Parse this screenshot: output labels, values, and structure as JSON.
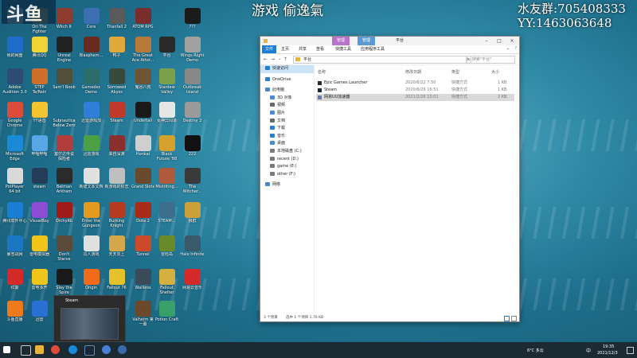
{
  "overlay": {
    "logo": "斗鱼",
    "game_text": "游戏 偷逸氣",
    "qq_group": "水友群:705408333",
    "yy": "YY:1463063648"
  },
  "desktop_icons": [
    {
      "label": "",
      "color": "#cfd6e6"
    },
    {
      "label": "Ori The Fighter",
      "color": "#c2a94a"
    },
    {
      "label": "Witch It",
      "color": "#8c3b2e"
    },
    {
      "label": "Core",
      "color": "#3b6fb1"
    },
    {
      "label": "Titanfall 2",
      "color": "#5a5a5a"
    },
    {
      "label": "ATOM RPG",
      "color": "#7b2c2c"
    },
    {
      "label": "???",
      "color": "#1b1b1b"
    },
    {
      "label": "我的网盘",
      "color": "#1f6ccc"
    },
    {
      "label": "腾讯QQ",
      "color": "#f0d335"
    },
    {
      "label": "Unreal Engine",
      "color": "#222222"
    },
    {
      "label": "Blasphem...",
      "color": "#6a2a20"
    },
    {
      "label": "鸭子",
      "color": "#e0a838"
    },
    {
      "label": "The Great Ace Attor...",
      "color": "#b77a3a"
    },
    {
      "label": "平台",
      "color": "#2a2a2a"
    },
    {
      "label": "Wings Right Demo",
      "color": "#a1a1a1"
    },
    {
      "label": "Adobe Audition 3.0",
      "color": "#2d4c74"
    },
    {
      "label": "STEP Ta/Rein",
      "color": "#cf6f2c"
    },
    {
      "label": "Sam'l Noob",
      "color": "#514e39"
    },
    {
      "label": "Gamedec Demo",
      "color": "#2c6d6a"
    },
    {
      "label": "Sorrowed Abyss",
      "color": "#394a3a"
    },
    {
      "label": "鬼谷八荒",
      "color": "#6d5535"
    },
    {
      "label": "Stardew Valley",
      "color": "#7ba14a"
    },
    {
      "label": "Outbreak Island",
      "color": "#888888"
    },
    {
      "label": "Google Chrome",
      "color": "#dd4c3a"
    },
    {
      "label": "YY语音",
      "color": "#f4c430"
    },
    {
      "label": "Subnautica Below Zero",
      "color": "#1d6d8c"
    },
    {
      "label": "迅雷游戏加",
      "color": "#2f7fd8"
    },
    {
      "label": "Steam",
      "color": "#c0392b"
    },
    {
      "label": "Undertail",
      "color": "#1a1a1a"
    },
    {
      "label": "女神异闻录",
      "color": "#e6e6e6"
    },
    {
      "label": "Destiny 2",
      "color": "#9a9a9a"
    },
    {
      "label": "Microsoft Edge",
      "color": "#1a8ad4"
    },
    {
      "label": "哔哩哔哩",
      "color": "#58a6e5"
    },
    {
      "label": "塞尔达传说 探险者",
      "color": "#b23b3b"
    },
    {
      "label": "迅雷游戏",
      "color": "#4aa042"
    },
    {
      "label": "来自深渊",
      "color": "#8c2f2f"
    },
    {
      "label": "Honkai",
      "color": "#cfcfcf"
    },
    {
      "label": "Black Future '88",
      "color": "#d4a12c"
    },
    {
      "label": "222",
      "color": "#111111"
    },
    {
      "label": "PotPlayer 64 bit",
      "color": "#d9d9d9"
    },
    {
      "label": "steam",
      "color": "#233d58"
    },
    {
      "label": "Batman Arkham",
      "color": "#2b2b2b"
    },
    {
      "label": "新建文本文档",
      "color": "#e0e0e0"
    },
    {
      "label": "新游戏的标志",
      "color": "#bfbfbf"
    },
    {
      "label": "Grand Slots",
      "color": "#6a4a2a"
    },
    {
      "label": "Mistriting...",
      "color": "#b05a3c"
    },
    {
      "label": "The Witcher...",
      "color": "#3a3a3a"
    },
    {
      "label": "腾讯软件中心",
      "color": "#1a7fd4"
    },
    {
      "label": "VisualBoy",
      "color": "#8c4cd4"
    },
    {
      "label": "OrchyRb",
      "color": "#a01a1a"
    },
    {
      "label": "Enter the Gungeon",
      "color": "#e39a20"
    },
    {
      "label": "Burning Knight",
      "color": "#b53a1f"
    },
    {
      "label": "Dota 2",
      "color": "#aa2a1a"
    },
    {
      "label": "STEAM...",
      "color": "#3d6d8c"
    },
    {
      "label": "狼群",
      "color": "#c9a03a"
    },
    {
      "label": "暴雪战网",
      "color": "#1c77c3"
    },
    {
      "label": "雷电模拟器",
      "color": "#f0c419"
    },
    {
      "label": "Don't Starve Together",
      "color": "#5a4a3a"
    },
    {
      "label": "同人游戏",
      "color": "#e0e0e0"
    },
    {
      "label": "天天向上",
      "color": "#d4a84a"
    },
    {
      "label": "Tunnel",
      "color": "#cc4a2a"
    },
    {
      "label": "冒险岛",
      "color": "#6a8a2a"
    },
    {
      "label": "Halo Infinite",
      "color": "#3a5a6a"
    },
    {
      "label": "红警",
      "color": "#d42a2a"
    },
    {
      "label": "雷电多开",
      "color": "#f0c419"
    },
    {
      "label": "Slay the Spire",
      "color": "#1a1a1a"
    },
    {
      "label": "Origin",
      "color": "#f06a1a"
    },
    {
      "label": "Fallout 76",
      "color": "#e6c22a"
    },
    {
      "label": "Wallless",
      "color": "#3a4a5a"
    },
    {
      "label": "Fallout Shelter",
      "color": "#d4b040"
    },
    {
      "label": "网易云音乐",
      "color": "#d42a2a"
    },
    {
      "label": "斗鱼直播",
      "color": "#f07a1a"
    },
    {
      "label": "迅雷",
      "color": "#2a6fd4"
    },
    {
      "label": "",
      "color": "#333333"
    },
    {
      "label": "",
      "color": "#333333"
    },
    {
      "label": "",
      "color": "#333333"
    },
    {
      "label": "Valheim 第一幕",
      "color": "#6a4a2a"
    },
    {
      "label": "Potion Craft",
      "color": "#3aa06a"
    }
  ],
  "explorer": {
    "ctx_tab_manage": "管理",
    "ctx_tab_manage2": "管理",
    "title": "平台",
    "ribbon_tabs": [
      "文件",
      "主页",
      "共享",
      "查看",
      "快捷工具",
      "应用程序工具"
    ],
    "path": "平台",
    "search_placeholder": "搜索\"平台\"",
    "nav_items": [
      {
        "label": "快速访问",
        "color": "#1d7ed4"
      },
      {
        "label": "OneDrive",
        "color": "#2a7fd4"
      },
      {
        "label": "此电脑",
        "color": "#4a8ad4"
      },
      {
        "label": "3D 对象",
        "color": "#4a8ad4"
      },
      {
        "label": "视频",
        "color": "#6a6a6a"
      },
      {
        "label": "图片",
        "color": "#4a8ad4"
      },
      {
        "label": "文档",
        "color": "#6a6a6a"
      },
      {
        "label": "下载",
        "color": "#2a7fd4"
      },
      {
        "label": "音乐",
        "color": "#2a7fd4"
      },
      {
        "label": "桌面",
        "color": "#4a8ad4"
      },
      {
        "label": "本地磁盘 (C:)",
        "color": "#7a7a7a"
      },
      {
        "label": "recent (D:)",
        "color": "#7a7a7a"
      },
      {
        "label": "game (E:)",
        "color": "#7a7a7a"
      },
      {
        "label": "other (F:)",
        "color": "#7a7a7a"
      },
      {
        "label": "网络",
        "color": "#4a8ad4"
      }
    ],
    "columns": {
      "name": "名称",
      "date": "修改日期",
      "type": "类型",
      "size": "大小"
    },
    "files": [
      {
        "name": "Epic Games Launcher",
        "date": "2020/6/22 7:50",
        "type": "快捷方式",
        "size": "1 KB",
        "icon_color": "#2a2a2a"
      },
      {
        "name": "Steam",
        "date": "2020/6/26 16:51",
        "type": "快捷方式",
        "size": "1 KB",
        "icon_color": "#1b2838"
      },
      {
        "name": "网易UU加速器",
        "date": "2021/2/26 13:01",
        "type": "快捷方式",
        "size": "2 KB",
        "icon_color": "#6a7aaa"
      }
    ],
    "status_left": "3 个项目",
    "status_selected": "选中 1 个项目  1.70 KB"
  },
  "taskbar": {
    "weather": "6°C 多云",
    "ime": "中",
    "time": "19:35",
    "date": "2021/12/3",
    "popup_title": "Steam"
  },
  "colors": {
    "accent": "#1d7ed4",
    "ctx_manage": "#b872c9",
    "ctx_manage2": "#5a9ad4"
  }
}
